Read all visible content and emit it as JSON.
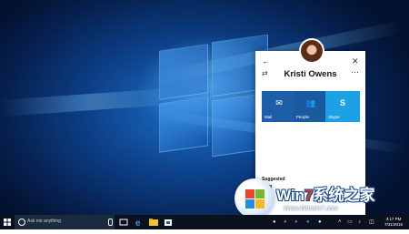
{
  "panel": {
    "contact_name": "Kristi Owens",
    "header_icons": [
      "back-arrow-icon",
      "close-icon",
      "swap-icon",
      "more-icon"
    ],
    "tiles": [
      {
        "label": "Mail",
        "icon": "mail-icon",
        "color": "#1c5fa8"
      },
      {
        "label": "People",
        "icon": "people-icon",
        "color": "#1a5a9e"
      },
      {
        "label": "Skype",
        "icon": "skype-icon",
        "color": "#1da1e5"
      }
    ],
    "suggested_label": "Suggested"
  },
  "taskbar": {
    "search_placeholder": "Ask me anything",
    "clock_time": "3:17 PM",
    "clock_date": "7/31/2016"
  },
  "watermark": {
    "text_prefix": "Win",
    "text_seven": "7",
    "text_suffix": "系统之家",
    "url": "Www.Winwin7.com"
  },
  "colors": {
    "accent": "#1c5fa8",
    "taskbar": "#0a1220"
  }
}
